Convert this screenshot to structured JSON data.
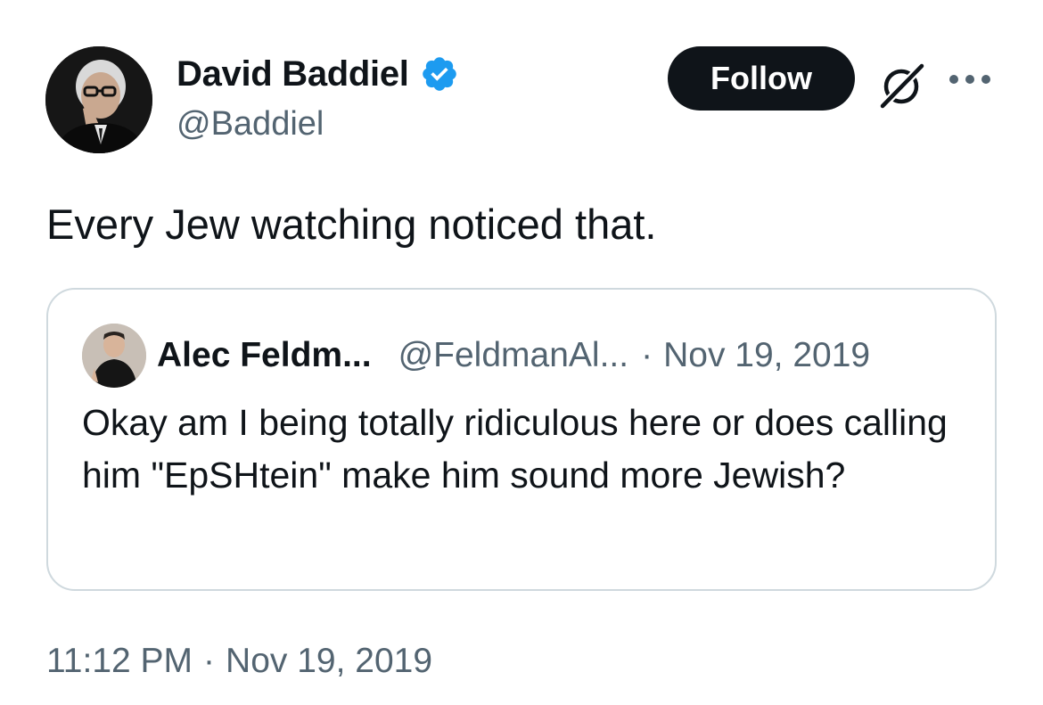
{
  "author": {
    "display_name": "David Baddiel",
    "handle": "@Baddiel",
    "verified": true
  },
  "actions": {
    "follow_label": "Follow",
    "grok_icon": "grok-slash-circle-icon",
    "more_icon": "more-dots-icon"
  },
  "tweet": {
    "text": "Every Jew watching noticed that.",
    "time": "11:12 PM",
    "separator": "·",
    "date": "Nov 19, 2019"
  },
  "quote": {
    "display_name": "Alec Feldm...",
    "handle": "@FeldmanAl...",
    "separator": "·",
    "date": "Nov 19, 2019",
    "text": "Okay am I being totally ridiculous here or does calling him \"EpSHtein\" make him sound more Jewish?"
  },
  "colors": {
    "text_primary": "#0f1419",
    "text_secondary": "#536471",
    "verified_blue": "#1d9bf0",
    "border": "#cfd9de",
    "follow_bg": "#0f1419"
  }
}
